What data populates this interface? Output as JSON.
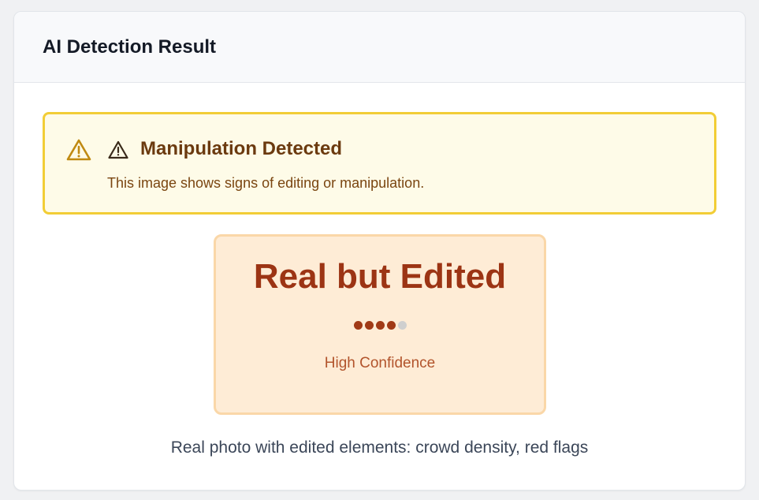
{
  "header": {
    "title": "AI Detection Result"
  },
  "alert": {
    "icon": "warning-triangle-icon",
    "title": "Manipulation Detected",
    "message": "This image shows signs of editing or manipulation.",
    "border_color": "#f2cd36",
    "background_color": "#fefbe8"
  },
  "verdict": {
    "label": "Real but Edited",
    "confidence_level": 4,
    "confidence_max": 5,
    "confidence_text": "High Confidence",
    "accent_color": "#9c3414",
    "background_color": "#feecd6"
  },
  "description": "Real photo with edited elements: crowd density, red flags"
}
